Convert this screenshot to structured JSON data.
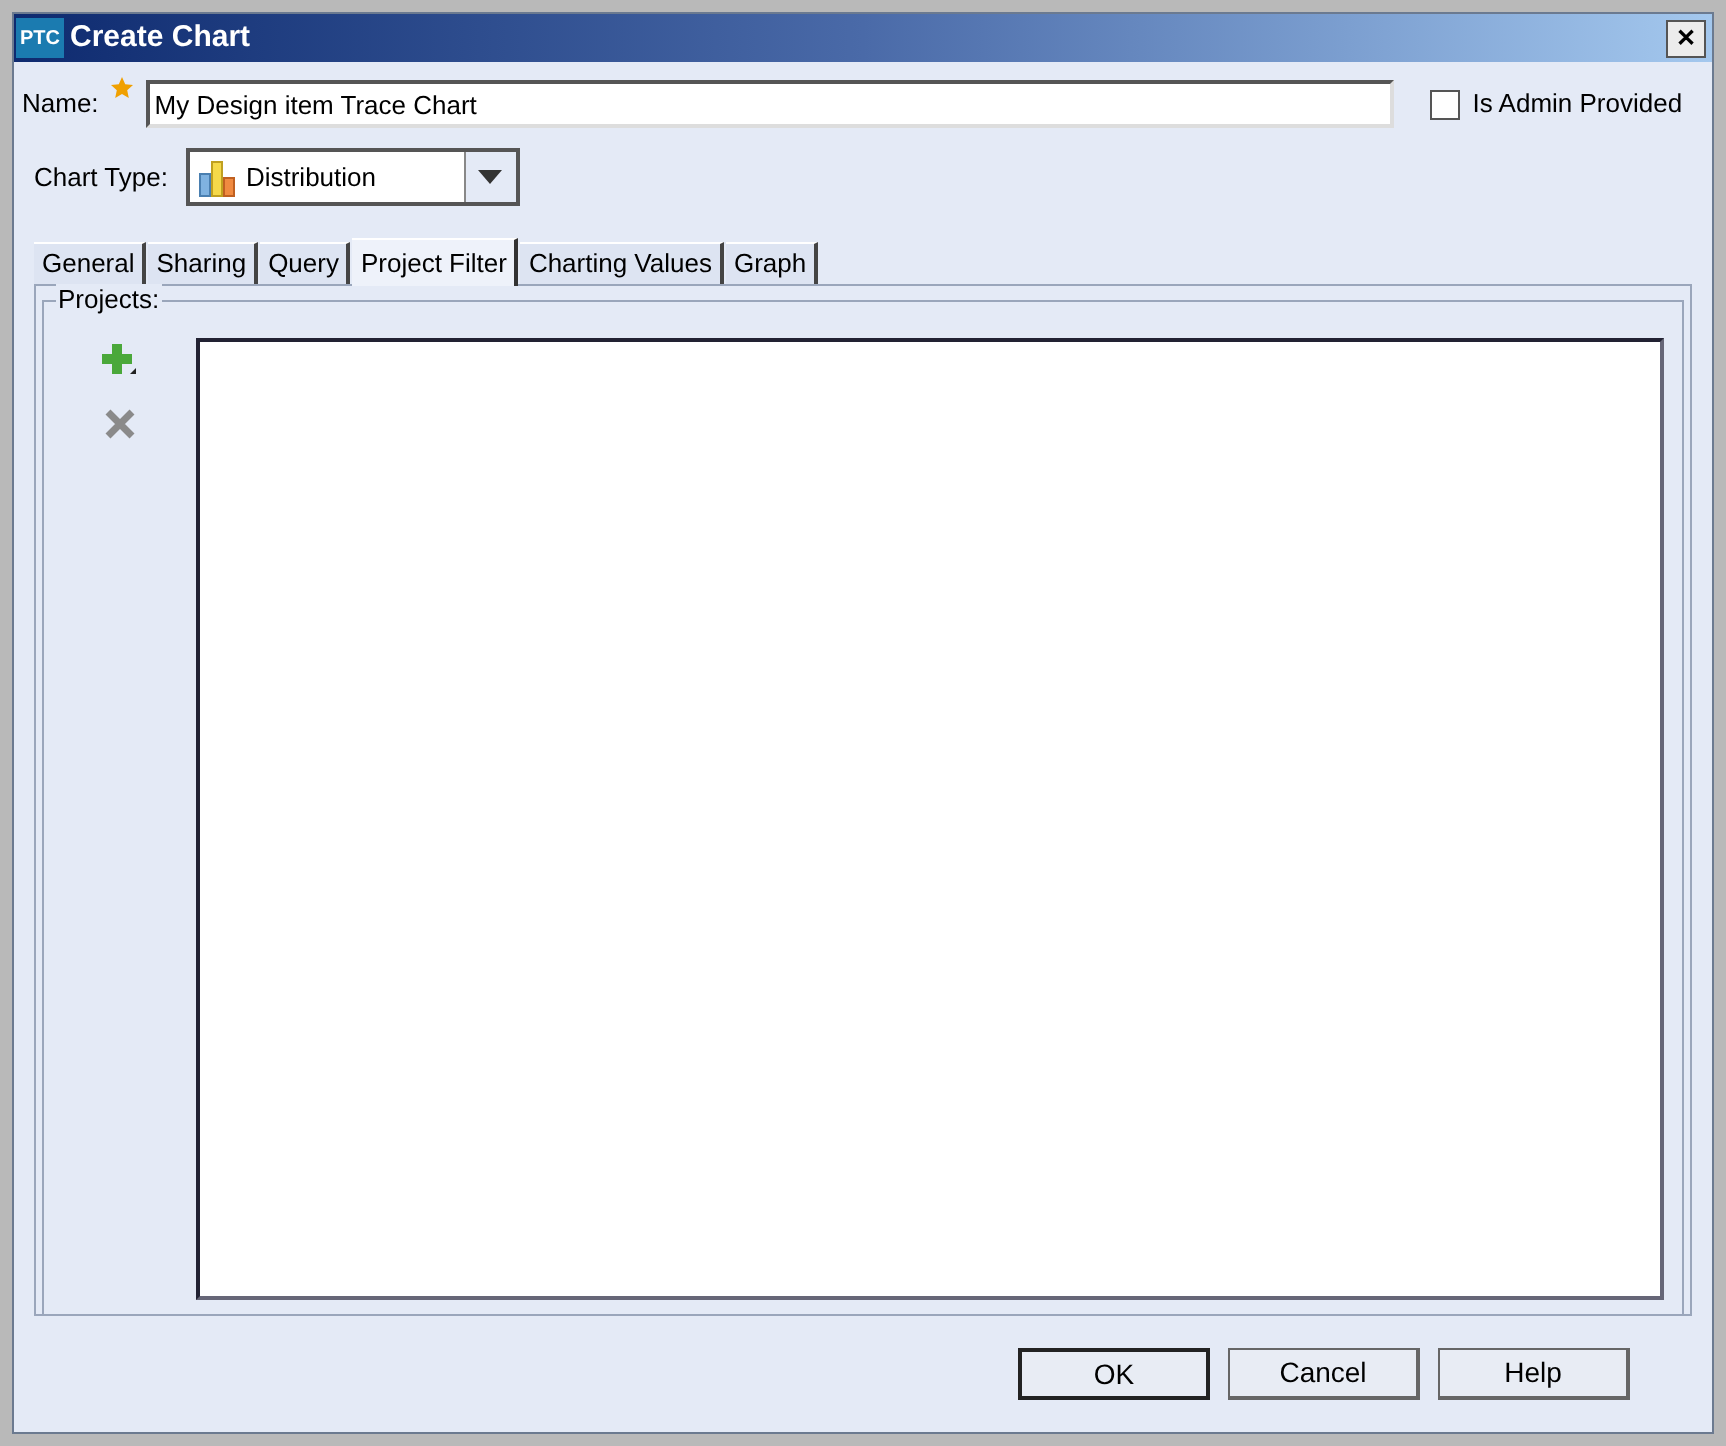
{
  "window": {
    "logo": "PTC",
    "title": "Create Chart",
    "close": "✕"
  },
  "name_field": {
    "label": "Name:",
    "required": true,
    "value": "My Design item Trace Chart"
  },
  "admin_checkbox": {
    "label": "Is Admin Provided",
    "checked": false
  },
  "chart_type": {
    "label": "Chart Type:",
    "value": "Distribution"
  },
  "tabs": [
    {
      "label": "General",
      "selected": false
    },
    {
      "label": "Sharing",
      "selected": false
    },
    {
      "label": "Query",
      "selected": false
    },
    {
      "label": "Project Filter",
      "selected": true
    },
    {
      "label": "Charting Values",
      "selected": false
    },
    {
      "label": "Graph",
      "selected": false
    }
  ],
  "projects": {
    "label": "Projects:",
    "add_disabled": false,
    "remove_disabled": true
  },
  "buttons": [
    {
      "label": "OK",
      "default": true
    },
    {
      "label": "Cancel",
      "default": false
    },
    {
      "label": "Help",
      "default": false
    }
  ]
}
